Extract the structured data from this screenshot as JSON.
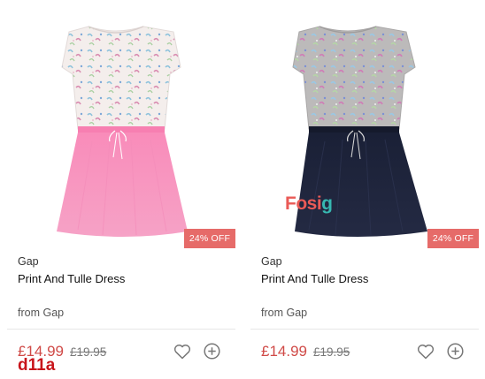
{
  "products": [
    {
      "brand": "Gap",
      "name": "Print And Tulle Dress",
      "seller": "from Gap",
      "price": "£14.99",
      "old_price": "£19.95",
      "discount": "24% OFF",
      "colors": {
        "top": "#f3ecea",
        "skirt": "#f78ab7"
      }
    },
    {
      "brand": "Gap",
      "name": "Print And Tulle Dress",
      "seller": "from Gap",
      "price": "£14.99",
      "old_price": "£19.95",
      "discount": "24% OFF",
      "colors": {
        "top": "#b9b7b7",
        "skirt": "#1c2237"
      }
    }
  ],
  "watermark": {
    "main": "Fosi",
    "accent": "g"
  },
  "corner_mark": "d11a",
  "accent_colors": {
    "badge": "#e66b69",
    "price": "#d04a47"
  }
}
